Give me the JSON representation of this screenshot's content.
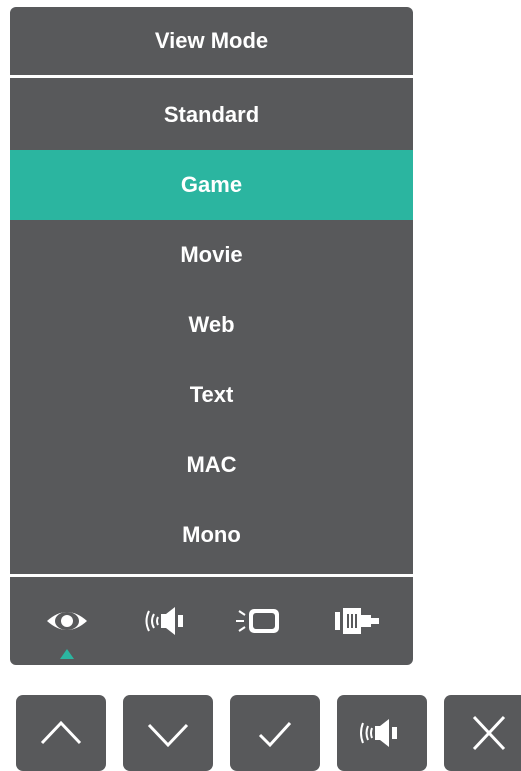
{
  "osd": {
    "title": "View Mode",
    "items": [
      {
        "label": "Standard"
      },
      {
        "label": "Game",
        "selected": true
      },
      {
        "label": "Movie"
      },
      {
        "label": "Web"
      },
      {
        "label": "Text"
      },
      {
        "label": "MAC"
      },
      {
        "label": "Mono"
      }
    ],
    "icon_tabs": [
      {
        "icon": "eye-icon",
        "active": true
      },
      {
        "icon": "audio-icon"
      },
      {
        "icon": "screen-settings-icon"
      },
      {
        "icon": "input-source-icon"
      }
    ]
  },
  "keys": [
    {
      "icon": "chevron-up-icon"
    },
    {
      "icon": "chevron-down-icon"
    },
    {
      "icon": "checkmark-icon"
    },
    {
      "icon": "audio-icon"
    },
    {
      "icon": "close-icon"
    }
  ],
  "colors": {
    "panel": "#58595b",
    "highlight": "#2bb5a0",
    "text": "#ffffff"
  }
}
